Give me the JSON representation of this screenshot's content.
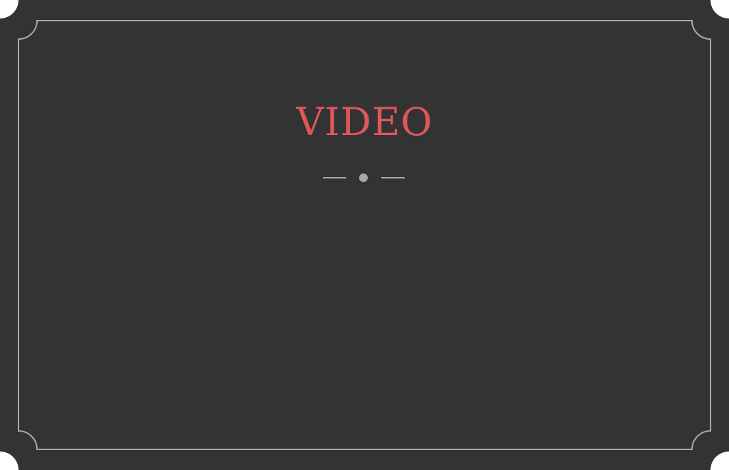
{
  "slide": {
    "title": "VIDEO"
  },
  "colors": {
    "background": "#333333",
    "title": "#e0575b",
    "frame": "#a8a8a8",
    "notch": "#ffffff"
  },
  "icons": {
    "divider": "line-dot-line-divider"
  }
}
